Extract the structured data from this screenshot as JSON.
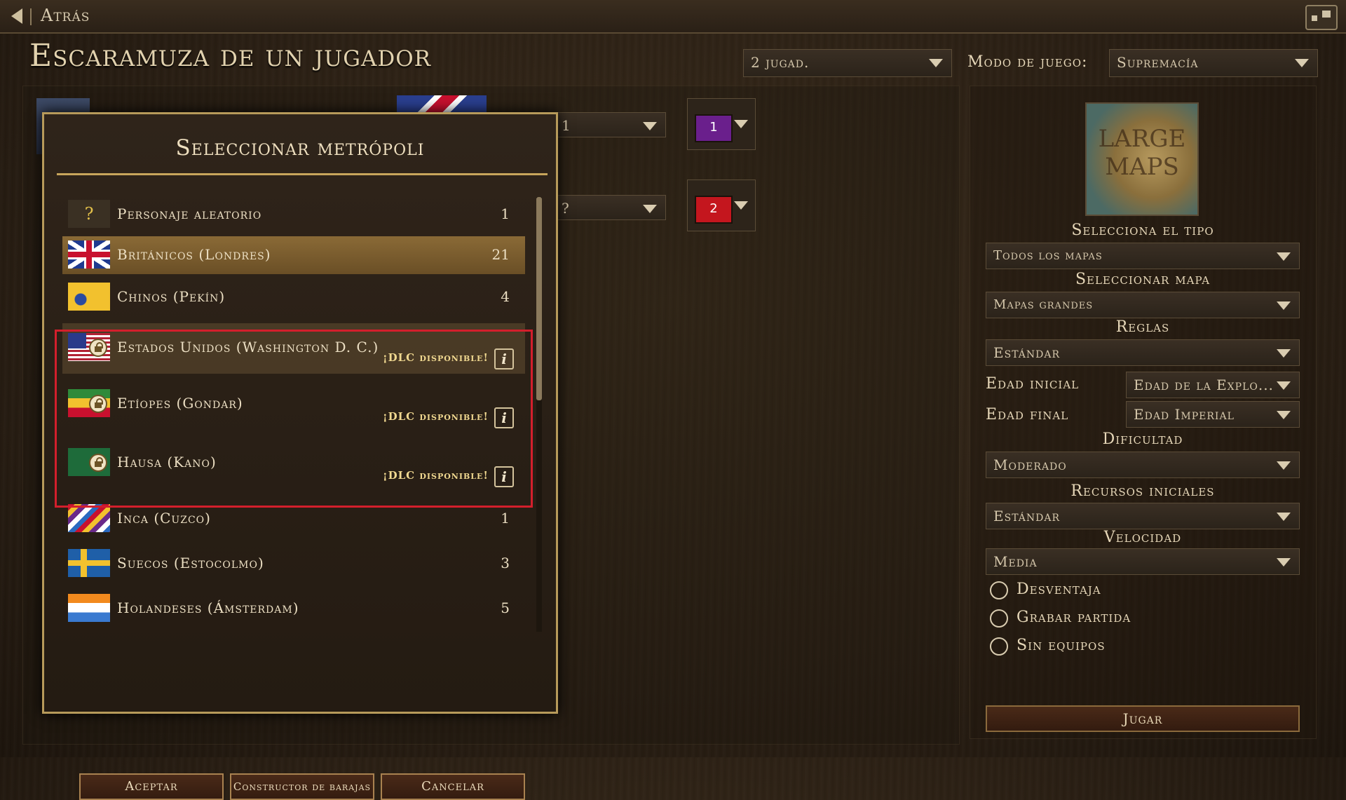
{
  "topbar": {
    "back_label": "Atrás"
  },
  "page_title": "Escaramuza de un jugador",
  "players": {
    "value": "2 jugad."
  },
  "game_mode": {
    "label": "Modo de juego:",
    "value": "Supremacía"
  },
  "player_slots": [
    {
      "team_value": "1",
      "team_color": "#6a1f8c",
      "dropdown_value": "1"
    },
    {
      "team_value": "2",
      "team_color": "#c4161e",
      "dropdown_value": "?"
    }
  ],
  "map_panel": {
    "thumb_text_1": "LARGE",
    "thumb_text_2": "MAPS",
    "type_label": "Selecciona el tipo",
    "type_value": "Todos los mapas",
    "map_label": "Seleccionar mapa",
    "map_value": "Mapas grandes",
    "rules_label": "Reglas",
    "rules_value": "Estándar",
    "start_age_label": "Edad inicial",
    "start_age_value": "Edad de la Explo...",
    "end_age_label": "Edad final",
    "end_age_value": "Edad Imperial",
    "difficulty_label": "Dificultad",
    "difficulty_value": "Moderado",
    "resources_label": "Recursos iniciales",
    "resources_value": "Estándar",
    "speed_label": "Velocidad",
    "speed_value": "Media",
    "handicap_label": "Desventaja",
    "record_label": "Grabar partida",
    "no_teams_label": "Sin equipos",
    "play_label": "Jugar"
  },
  "modal": {
    "title": "Seleccionar metrópoli",
    "rows": [
      {
        "name": "Personaje aleatorio",
        "count": "1",
        "flag": "random-icon"
      },
      {
        "name": "Británicos (Londres)",
        "count": "21",
        "flag": "uk-flag"
      },
      {
        "name": "Chinos (Pekín)",
        "count": "4",
        "flag": "china-flag"
      },
      {
        "name": "Estados Unidos (Washington D. C.)",
        "dlc": "¡DLC disponible!",
        "flag": "usa-flag"
      },
      {
        "name": "Etíopes (Gondar)",
        "dlc": "¡DLC disponible!",
        "flag": "ethiopia-flag"
      },
      {
        "name": "Hausa (Kano)",
        "dlc": "¡DLC disponible!",
        "flag": "hausa-flag"
      },
      {
        "name": "Inca (Cuzco)",
        "count": "1",
        "flag": "inca-flag"
      },
      {
        "name": "Suecos (Estocolmo)",
        "count": "3",
        "flag": "sweden-flag"
      },
      {
        "name": "Holandeses (Ámsterdam)",
        "count": "5",
        "flag": "netherlands-flag"
      }
    ],
    "info_symbol": "i",
    "random_symbol": "?",
    "accept_label": "Aceptar",
    "deck_builder_label": "Constructor de barajas",
    "cancel_label": "Cancelar"
  }
}
